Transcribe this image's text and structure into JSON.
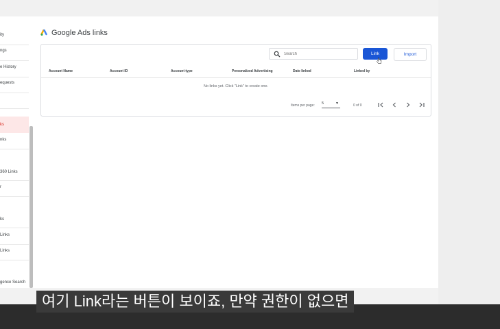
{
  "sidebar": {
    "items": [
      {
        "label": "ity"
      },
      {
        "label": "ngs"
      },
      {
        "label": "e History"
      },
      {
        "label": "equests"
      },
      {
        "label": "ks"
      },
      {
        "label": "nks"
      },
      {
        "label": "360 Links"
      },
      {
        "label": "r"
      },
      {
        "label": "ks"
      },
      {
        "label": "Links"
      },
      {
        "label": "Links"
      },
      {
        "label": "gence Search"
      }
    ]
  },
  "page": {
    "title": "Google Ads links"
  },
  "toolbar": {
    "search_placeholder": "Search",
    "link_label": "Link",
    "import_label": "Import"
  },
  "table": {
    "columns": [
      "Account Name",
      "Account ID",
      "Account type",
      "Personalized Advertising",
      "Date linked",
      "Linked by"
    ],
    "empty_message": "No links yet. Click \"Link\" to create one."
  },
  "pagination": {
    "items_per_page_label": "Items per page:",
    "items_per_page_value": "5",
    "range_label": "0 of 0"
  },
  "caption": {
    "text": "여기 Link라는 버튼이 보이죠, 만약 권한이 없으면"
  },
  "colors": {
    "primary": "#1a56d6",
    "active_item": "#d93025"
  }
}
